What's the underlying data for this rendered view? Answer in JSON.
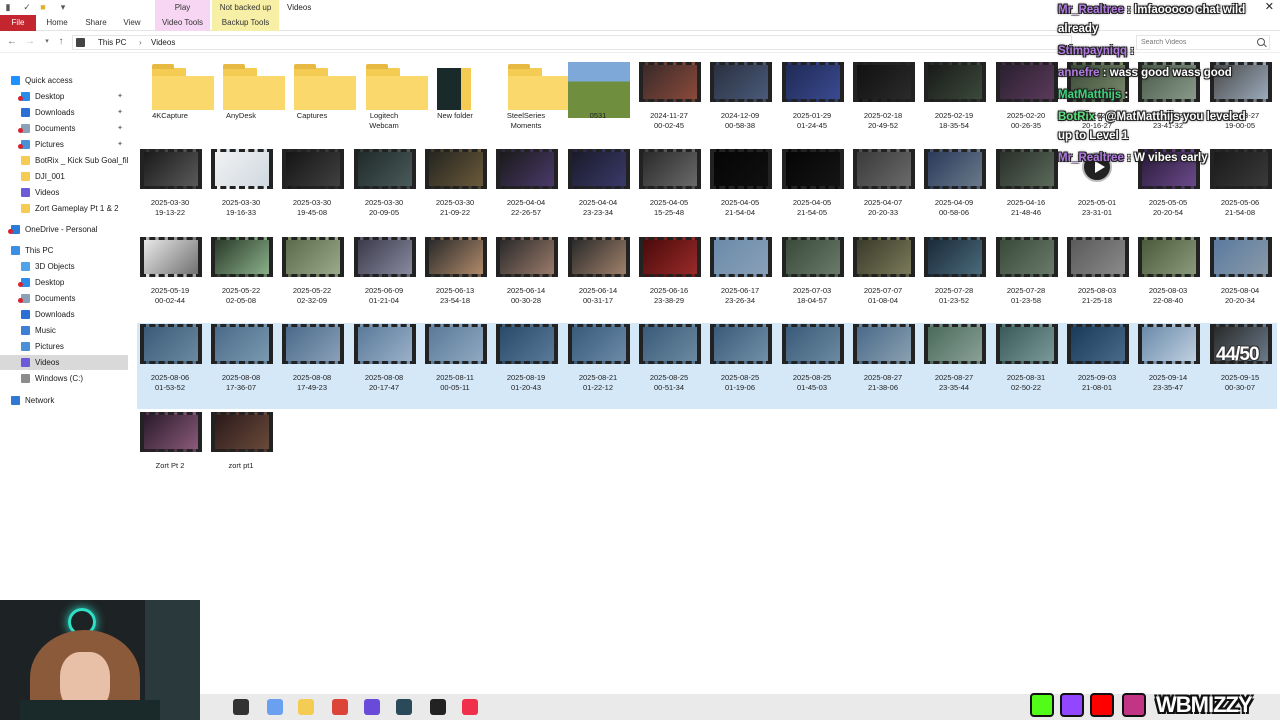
{
  "window": {
    "title": "Videos",
    "ctx_play": "Play",
    "ctx_not_backed_up": "Not backed up",
    "close_glyph": "✕"
  },
  "ribbon": {
    "file": "File",
    "home": "Home",
    "share": "Share",
    "view": "View",
    "video_tools": "Video Tools",
    "backup_tools": "Backup Tools"
  },
  "address": {
    "crumb_pc": "This PC",
    "separator": "›",
    "crumb_videos": "Videos",
    "search_placeholder": "Search Videos"
  },
  "navpane": {
    "items": [
      {
        "label": "Quick access",
        "indent": 0,
        "icon": "star-icon",
        "color": "#1e90ff",
        "pin": false,
        "badge": false
      },
      {
        "label": "Desktop",
        "indent": 1,
        "icon": "desktop-icon",
        "color": "#2a8be8",
        "pin": true,
        "badge": true
      },
      {
        "label": "Downloads",
        "indent": 1,
        "icon": "download-icon",
        "color": "#2a6fd6",
        "pin": true,
        "badge": false
      },
      {
        "label": "Documents",
        "indent": 1,
        "icon": "documents-icon",
        "color": "#8aa1b8",
        "pin": true,
        "badge": true
      },
      {
        "label": "Pictures",
        "indent": 1,
        "icon": "pictures-icon",
        "color": "#4a90d9",
        "pin": true,
        "badge": true
      },
      {
        "label": "BotRix _ Kick Sub Goal_file",
        "indent": 1,
        "icon": "folder-icon",
        "color": "#f5cc53",
        "pin": false,
        "badge": false
      },
      {
        "label": "DJI_001",
        "indent": 1,
        "icon": "folder-icon",
        "color": "#f5cc53",
        "pin": false,
        "badge": false
      },
      {
        "label": "Videos",
        "indent": 1,
        "icon": "videos-icon",
        "color": "#6b5bd6",
        "pin": false,
        "badge": false
      },
      {
        "label": "Zort Gameplay Pt 1 & 2",
        "indent": 1,
        "icon": "folder-icon",
        "color": "#f5cc53",
        "pin": false,
        "badge": false
      },
      {
        "label": "OneDrive - Personal",
        "indent": 0,
        "icon": "cloud-icon",
        "color": "#2a7ad8",
        "pin": false,
        "badge": true
      },
      {
        "label": "This PC",
        "indent": 0,
        "icon": "computer-icon",
        "color": "#3a8ee6",
        "pin": false,
        "badge": false
      },
      {
        "label": "3D Objects",
        "indent": 1,
        "icon": "cube-icon",
        "color": "#4fa3e8",
        "pin": false,
        "badge": false
      },
      {
        "label": "Desktop",
        "indent": 1,
        "icon": "desktop-icon",
        "color": "#2a8be8",
        "pin": false,
        "badge": true
      },
      {
        "label": "Documents",
        "indent": 1,
        "icon": "documents-icon",
        "color": "#8aa1b8",
        "pin": false,
        "badge": true
      },
      {
        "label": "Downloads",
        "indent": 1,
        "icon": "download-icon",
        "color": "#2a6fd6",
        "pin": false,
        "badge": false
      },
      {
        "label": "Music",
        "indent": 1,
        "icon": "music-icon",
        "color": "#3f7fd6",
        "pin": false,
        "badge": false
      },
      {
        "label": "Pictures",
        "indent": 1,
        "icon": "pictures-icon",
        "color": "#4a90d9",
        "pin": false,
        "badge": false
      },
      {
        "label": "Videos",
        "indent": 1,
        "icon": "videos-icon",
        "color": "#6b5bd6",
        "pin": false,
        "badge": false,
        "selected": true
      },
      {
        "label": "Windows (C:)",
        "indent": 1,
        "icon": "drive-icon",
        "color": "#8c8c8c",
        "pin": false,
        "badge": false
      },
      {
        "label": "Network",
        "indent": 0,
        "icon": "network-icon",
        "color": "#2f78d4",
        "pin": false,
        "badge": false
      }
    ]
  },
  "files": [
    {
      "name": "4KCapture",
      "type": "folder"
    },
    {
      "name": "AnyDesk",
      "type": "folder"
    },
    {
      "name": "Captures",
      "type": "folder"
    },
    {
      "name": "Logitech\nWebcam",
      "type": "folder"
    },
    {
      "name": "New folder",
      "type": "folder-dark"
    },
    {
      "name": "SteelSeries\nMoments",
      "type": "folder"
    },
    {
      "name": "0531",
      "type": "photo",
      "c1": "#7da8d8",
      "c2": "#6f8f3f"
    },
    {
      "name": "2024-11-27\n00-02-45",
      "type": "video",
      "c1": "#3a2a2a",
      "c2": "#8a4a3a"
    },
    {
      "name": "2024-12-09\n00-58-38",
      "type": "video",
      "c1": "#2a3040",
      "c2": "#4a5a7a"
    },
    {
      "name": "2025-01-29\n01-24-45",
      "type": "video",
      "c1": "#1f2a55",
      "c2": "#3a4a90"
    },
    {
      "name": "2025-02-18\n20-49-52",
      "type": "video",
      "c1": "#111",
      "c2": "#2a2a2a"
    },
    {
      "name": "2025-02-19\n18-35-54",
      "type": "video",
      "c1": "#1a1a1a",
      "c2": "#3a4a3a"
    },
    {
      "name": "2025-02-20\n00-26-35",
      "type": "video",
      "c1": "#2a2030",
      "c2": "#5a3a5a"
    },
    {
      "name": "2025-02-22\n20-16-27",
      "type": "video",
      "c1": "#3a4a3a",
      "c2": "#7a8a6a"
    },
    {
      "name": "2025-02-27\n23-41-32",
      "type": "video",
      "c1": "#4a5a4a",
      "c2": "#8a9a8a"
    },
    {
      "name": "2025-03-27\n19-00-05",
      "type": "video",
      "c1": "#4a4a4a",
      "c2": "#9aaabb"
    },
    {
      "name": "2025-03-30\n19-13-22",
      "type": "video",
      "c1": "#1a1a1a",
      "c2": "#5a5a5a"
    },
    {
      "name": "2025-03-30\n19-16-33",
      "type": "video-light",
      "c1": "#f2f2f2",
      "c2": "#cfd8e0"
    },
    {
      "name": "2025-03-30\n19-45-08",
      "type": "video",
      "c1": "#151515",
      "c2": "#404040"
    },
    {
      "name": "2025-03-30\n20-09-05",
      "type": "video",
      "c1": "#202a2a",
      "c2": "#4a5a5a"
    },
    {
      "name": "2025-03-30\n21-09-22",
      "type": "video",
      "c1": "#252520",
      "c2": "#6a5a3a"
    },
    {
      "name": "2025-04-04\n22-26-57",
      "type": "video",
      "c1": "#1a1a1a",
      "c2": "#4a3a6a"
    },
    {
      "name": "2025-04-04\n23-23-34",
      "type": "video",
      "c1": "#1a1a2a",
      "c2": "#3a3a6a"
    },
    {
      "name": "2025-04-05\n15-25-48",
      "type": "video",
      "c1": "#2a2a2a",
      "c2": "#6a6a6a"
    },
    {
      "name": "2025-04-05\n21-54-04",
      "type": "video",
      "c1": "#050505",
      "c2": "#101010"
    },
    {
      "name": "2025-04-05\n21-54-05",
      "type": "video",
      "c1": "#050505",
      "c2": "#151515"
    },
    {
      "name": "2025-04-07\n20-20-33",
      "type": "video",
      "c1": "#3a3a3a",
      "c2": "#6a6a6a"
    },
    {
      "name": "2025-04-09\n00-58-06",
      "type": "video",
      "c1": "#2a3a5a",
      "c2": "#6a7a8a"
    },
    {
      "name": "2025-04-16\n21-48-46",
      "type": "video",
      "c1": "#2a2f2a",
      "c2": "#5a6a5a"
    },
    {
      "name": "2025-05-01\n23-31-01",
      "type": "play",
      "c1": "#fff",
      "c2": "#fff"
    },
    {
      "name": "2025-05-05\n20-20-54",
      "type": "video",
      "c1": "#2a1a3a",
      "c2": "#6a4a8a"
    },
    {
      "name": "2025-05-06\n21-54-08",
      "type": "video",
      "c1": "#1a1a1a",
      "c2": "#3a3a3a"
    },
    {
      "name": "2025-05-19\n00-02-44",
      "type": "video-light",
      "c1": "#e8e8e8",
      "c2": "#707070"
    },
    {
      "name": "2025-05-22\n02-05-08",
      "type": "video",
      "c1": "#2a3a2a",
      "c2": "#8ab08a"
    },
    {
      "name": "2025-05-22\n02-32-09",
      "type": "video",
      "c1": "#5a6a4a",
      "c2": "#9aaa8a"
    },
    {
      "name": "2025-06-09\n01-21-04",
      "type": "video",
      "c1": "#3a3a4a",
      "c2": "#8a8aa0"
    },
    {
      "name": "2025-06-13\n23-54-18",
      "type": "video",
      "c1": "#2a2a2a",
      "c2": "#b08a6a"
    },
    {
      "name": "2025-06-14\n00-30-28",
      "type": "video",
      "c1": "#2a2a2a",
      "c2": "#9a7a6a"
    },
    {
      "name": "2025-06-14\n00-31-17",
      "type": "video",
      "c1": "#2a2a2a",
      "c2": "#a0806a"
    },
    {
      "name": "2025-06-16\n23-38-29",
      "type": "video",
      "c1": "#4a0a0a",
      "c2": "#9a2a2a"
    },
    {
      "name": "2025-06-17\n23-26-34",
      "type": "video",
      "c1": "#6a8aaa",
      "c2": "#8aa0b8"
    },
    {
      "name": "2025-07-03\n18-04-57",
      "type": "video",
      "c1": "#3a4a3a",
      "c2": "#6a7a6a"
    },
    {
      "name": "2025-07-07\n01-08-04",
      "type": "video",
      "c1": "#3a3a2a",
      "c2": "#7a7a5a"
    },
    {
      "name": "2025-07-28\n01-23-52",
      "type": "video",
      "c1": "#1a2a3a",
      "c2": "#4a6a7a"
    },
    {
      "name": "2025-07-28\n01-23-58",
      "type": "video",
      "c1": "#3a4a3a",
      "c2": "#6a7a6a"
    },
    {
      "name": "2025-08-03\n21-25-18",
      "type": "video",
      "c1": "#5a5a5a",
      "c2": "#8a8a8a"
    },
    {
      "name": "2025-08-03\n22-08-40",
      "type": "video",
      "c1": "#4a5a3a",
      "c2": "#8a9a7a"
    },
    {
      "name": "2025-08-04\n20-20-34",
      "type": "video",
      "c1": "#5a7aa0",
      "c2": "#8a9aa8"
    },
    {
      "name": "2025-08-06\n01-53-52",
      "type": "video",
      "c1": "#3a5a7a",
      "c2": "#6a8aa0",
      "sel": true
    },
    {
      "name": "2025-08-08\n17-36-07",
      "type": "video",
      "c1": "#4a6a8a",
      "c2": "#7a9ab0",
      "sel": true
    },
    {
      "name": "2025-08-08\n17-49-23",
      "type": "video",
      "c1": "#4a6a8a",
      "c2": "#8aa0b8",
      "sel": true
    },
    {
      "name": "2025-08-08\n20-17-47",
      "type": "video",
      "c1": "#5a7a9a",
      "c2": "#9ab0c8",
      "sel": true
    },
    {
      "name": "2025-08-11\n00-05-11",
      "type": "video",
      "c1": "#5a7a9a",
      "c2": "#90a8c0",
      "sel": true
    },
    {
      "name": "2025-08-19\n01-20-43",
      "type": "video",
      "c1": "#2a4a6a",
      "c2": "#5a7a9a",
      "sel": true
    },
    {
      "name": "2025-08-21\n01-22-12",
      "type": "video",
      "c1": "#3a5a7a",
      "c2": "#6a8aa8",
      "sel": true
    },
    {
      "name": "2025-08-25\n00-51-34",
      "type": "video",
      "c1": "#3a5a7a",
      "c2": "#6a8aa0",
      "sel": true
    },
    {
      "name": "2025-08-25\n01-19-06",
      "type": "video",
      "c1": "#3a5a7a",
      "c2": "#7090a8",
      "sel": true
    },
    {
      "name": "2025-08-25\n01-45-03",
      "type": "video",
      "c1": "#3a5a7a",
      "c2": "#6a8aa0",
      "sel": true
    },
    {
      "name": "2025-08-27\n21-38-06",
      "type": "video",
      "c1": "#4a6a8a",
      "c2": "#8aa0b0",
      "sel": true
    },
    {
      "name": "2025-08-27\n23-35-44",
      "type": "video",
      "c1": "#4a6a5a",
      "c2": "#8aa098",
      "sel": true
    },
    {
      "name": "2025-08-31\n02-50-22",
      "type": "video",
      "c1": "#3a5a5a",
      "c2": "#7a9a9a",
      "sel": true
    },
    {
      "name": "2025-09-03\n21-08-01",
      "type": "video",
      "c1": "#1a3a5a",
      "c2": "#4a6a8a",
      "sel": true
    },
    {
      "name": "2025-09-14\n23-35-47",
      "type": "video",
      "c1": "#6a8aaa",
      "c2": "#c0d0e0",
      "sel": true
    },
    {
      "name": "2025-09-15\n00-30-07",
      "type": "video",
      "c1": "#2a2a2a",
      "c2": "#6a7a8a",
      "sel": true
    },
    {
      "name": "Zort Pt 2",
      "type": "video",
      "c1": "#2a1a2a",
      "c2": "#8a5a7a"
    },
    {
      "name": "zort pt1",
      "type": "video",
      "c1": "#2a1a1a",
      "c2": "#6a4a3a"
    }
  ],
  "overlay_counter": "44/50",
  "chat": [
    {
      "user": "Mr_Realtree",
      "sep": " : ",
      "msg": "lmfaooooo chat wild",
      "cls": ""
    },
    {
      "user": "",
      "sep": "",
      "msg": "already",
      "cls": ""
    },
    {
      "user": "Stimpayniqq",
      "sep": " : ",
      "msg": "",
      "cls": ""
    },
    {
      "user": "annefre",
      "sep": " : ",
      "msg": "wass good wass good",
      "cls": ""
    },
    {
      "user": "MatMatthijs",
      "sep": " :",
      "msg": "",
      "cls": "green"
    },
    {
      "user": "BotRix",
      "sep": " : ",
      "msg": "@MatMatthijs you leveled",
      "cls": "grn2"
    },
    {
      "user": "",
      "sep": "",
      "msg": "up to Level 1",
      "cls": ""
    },
    {
      "user": "Mr_Realtree",
      "sep": " : ",
      "msg": "W vibes early",
      "cls": ""
    }
  ],
  "socials": {
    "handle": "WBMIZZY",
    "kick": "#53fc18",
    "twitch": "#9146ff",
    "youtube": "#ff0000",
    "instagram": "#c13584"
  },
  "taskbar": [
    {
      "icon": "taskview-icon",
      "color": "#333"
    },
    {
      "icon": "copilot-icon",
      "color": "#6aa0f0"
    },
    {
      "icon": "file-explorer-icon",
      "color": "#f5cc53"
    },
    {
      "icon": "chrome-icon",
      "color": "#db4437"
    },
    {
      "icon": "messenger-icon",
      "color": "#6a4ad8"
    },
    {
      "icon": "app-icon",
      "color": "#2a4a5a"
    },
    {
      "icon": "obs-icon",
      "color": "#222"
    },
    {
      "icon": "music-app-icon",
      "color": "#f0304a"
    }
  ]
}
